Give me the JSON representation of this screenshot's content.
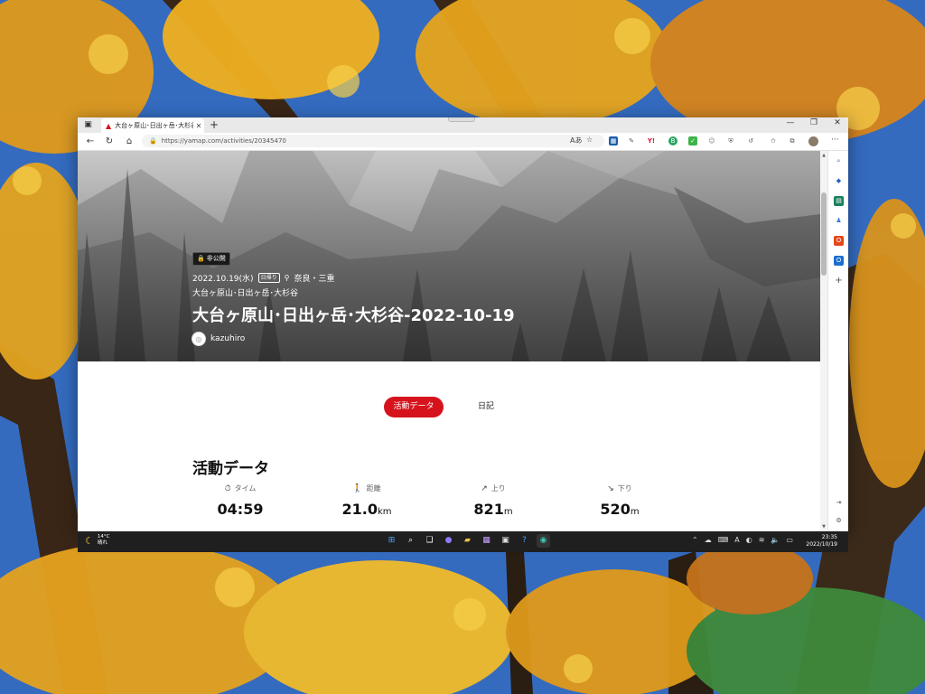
{
  "browser": {
    "tab_title": "大台ヶ原山･日出ヶ岳･大杉谷-20...",
    "url": "https://yamap.com/activities/20345470"
  },
  "hero": {
    "private_label": "非公開",
    "date": "2022.10.19(水)",
    "day_hike_tag": "日帰り",
    "location": "奈良・三重",
    "area": "大台ヶ原山･日出ヶ岳･大杉谷",
    "title": "大台ヶ原山･日出ヶ岳･大杉谷-2022-10-19",
    "username": "kazuhiro"
  },
  "page_tabs": {
    "active": "活動データ",
    "other": "日記"
  },
  "activity": {
    "section_title": "活動データ",
    "stats": [
      {
        "label": "タイム",
        "value": "04:59",
        "unit": "",
        "icon": "stopwatch-icon"
      },
      {
        "label": "距離",
        "value": "21.0",
        "unit": "km",
        "icon": "walker-icon"
      },
      {
        "label": "上り",
        "value": "821",
        "unit": "m",
        "icon": "arrow-up-right-icon"
      },
      {
        "label": "下り",
        "value": "520",
        "unit": "m",
        "icon": "arrow-down-right-icon"
      }
    ]
  },
  "taskbar": {
    "weather_temp": "14°C",
    "weather_desc": "晴れ",
    "time": "23:35",
    "date": "2022/10/19"
  },
  "colors": {
    "accent_red": "#d6131c",
    "hero_gray": "#c8c8c8",
    "taskbar": "#1f1f1f"
  }
}
